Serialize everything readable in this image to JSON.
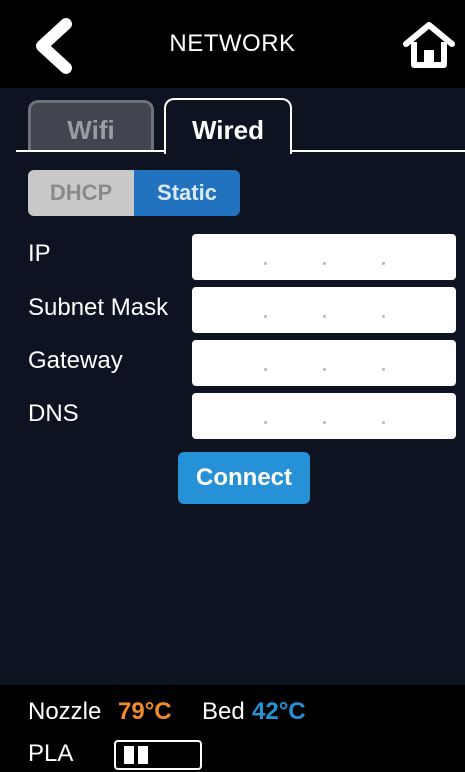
{
  "header": {
    "title": "NETWORK",
    "back_icon": "chevron-left-icon",
    "home_icon": "home-icon"
  },
  "tabs": [
    {
      "label": "Wifi",
      "active": false
    },
    {
      "label": "Wired",
      "active": true
    }
  ],
  "mode": {
    "options": [
      "DHCP",
      "Static"
    ],
    "selected": "Static"
  },
  "fields": [
    {
      "label": "IP",
      "value": ""
    },
    {
      "label": "Subnet Mask",
      "value": ""
    },
    {
      "label": "Gateway",
      "value": ""
    },
    {
      "label": "DNS",
      "value": ""
    }
  ],
  "connect_label": "Connect",
  "footer": {
    "nozzle_label": "Nozzle",
    "nozzle_value": "79°C",
    "bed_label": "Bed",
    "bed_value": "42°C",
    "filament_label": "PLA"
  },
  "colors": {
    "background": "#0d1320",
    "accent_blue": "#2691d7",
    "static_blue": "#2273bf",
    "nozzle_orange": "#f08a2a"
  }
}
